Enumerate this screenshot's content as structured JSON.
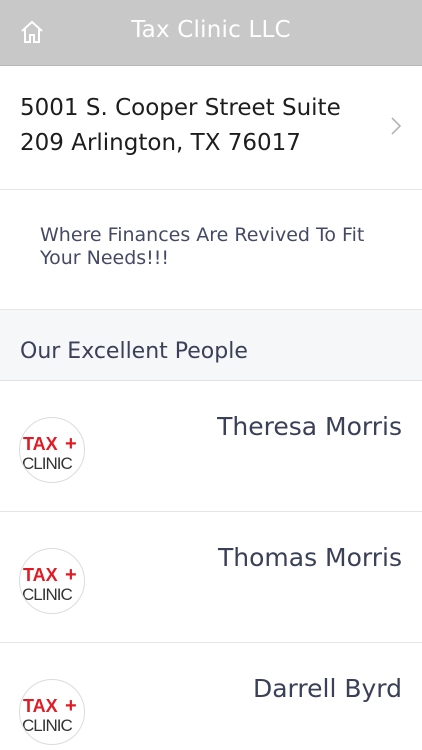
{
  "header": {
    "title": "Tax Clinic LLC",
    "home_icon": "home-icon"
  },
  "address": {
    "line1": "5001 S. Cooper Street Suite",
    "line2": "209 Arlington, TX 76017",
    "chevron_icon": "chevron-right-icon"
  },
  "tagline": "Where Finances Are Revived To Fit Your Needs!!!",
  "section": {
    "title": "Our Excellent People"
  },
  "people": [
    {
      "name": "Theresa Morris",
      "logo_text_top": "TAX",
      "logo_text_bottom": "CLINIC"
    },
    {
      "name": "Thomas Morris",
      "logo_text_top": "TAX",
      "logo_text_bottom": "CLINIC"
    },
    {
      "name": "Darrell Byrd",
      "logo_text_top": "TAX",
      "logo_text_bottom": "CLINIC"
    }
  ],
  "colors": {
    "header_bg": "#c8c8c8",
    "logo_red": "#e01b24",
    "logo_dark": "#333333"
  }
}
